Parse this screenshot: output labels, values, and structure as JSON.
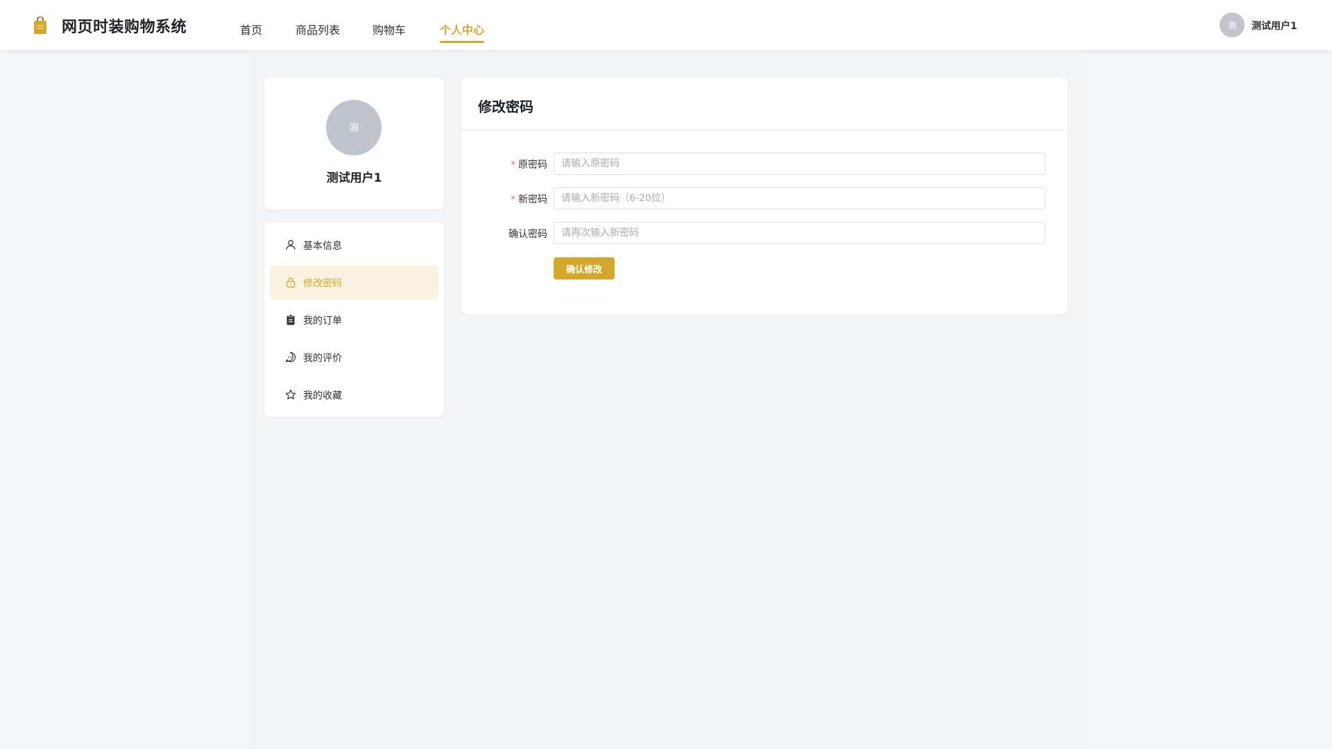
{
  "header": {
    "title": "网页时装购物系统",
    "logo_icon": "shopping-bag-icon",
    "nav": [
      {
        "label": "首页",
        "active": false
      },
      {
        "label": "商品列表",
        "active": false
      },
      {
        "label": "购物车",
        "active": false
      },
      {
        "label": "个人中心",
        "active": true
      }
    ],
    "user": {
      "avatar_text": "测",
      "name": "测试用户1"
    }
  },
  "profile": {
    "avatar_text": "测",
    "name": "测试用户1"
  },
  "menu": [
    {
      "label": "基本信息",
      "icon": "user-icon",
      "active": false
    },
    {
      "label": "修改密码",
      "icon": "lock-icon",
      "active": true
    },
    {
      "label": "我的订单",
      "icon": "clipboard-icon",
      "active": false
    },
    {
      "label": "我的评价",
      "icon": "chat-bubble-icon",
      "active": false
    },
    {
      "label": "我的收藏",
      "icon": "star-icon",
      "active": false
    }
  ],
  "password_form": {
    "title": "修改密码",
    "fields": [
      {
        "label": "原密码",
        "required": true,
        "placeholder": "请输入原密码",
        "value": ""
      },
      {
        "label": "新密码",
        "required": true,
        "placeholder": "请输入新密码（6-20位）",
        "value": ""
      },
      {
        "label": "确认密码",
        "required": false,
        "placeholder": "请再次输入新密码",
        "value": ""
      }
    ],
    "submit_label": "确认修改"
  },
  "colors": {
    "accent": "#d4a82c",
    "accent_light": "#fbf3e1",
    "required": "#f56c6c",
    "page_bg": "#f5f6f8",
    "avatar_bg": "#c0c4cc"
  }
}
